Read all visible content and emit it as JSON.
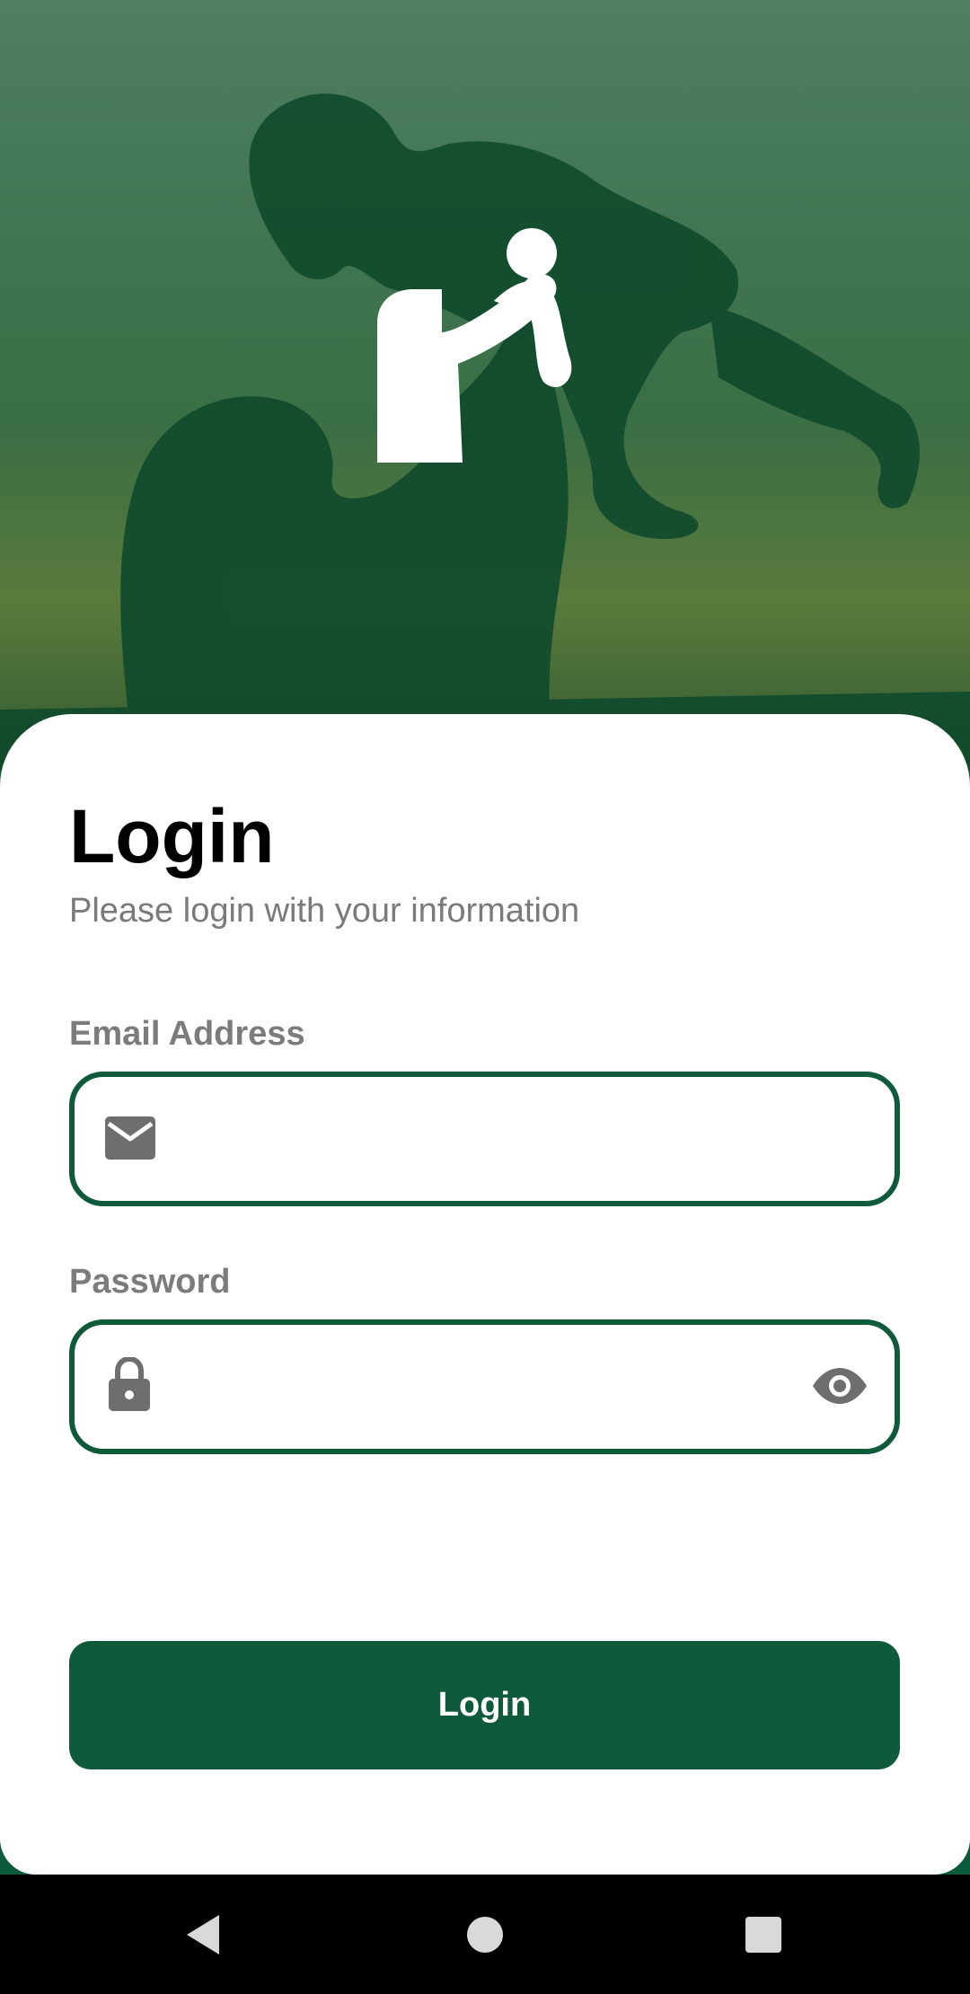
{
  "login": {
    "title": "Login",
    "subtitle": "Please login with your information"
  },
  "email": {
    "label": "Email Address",
    "value": "",
    "placeholder": "",
    "icon": "mail-icon"
  },
  "password": {
    "label": "Password",
    "value": "",
    "placeholder": "",
    "icon": "lock-icon",
    "toggle_icon": "eye-icon"
  },
  "actions": {
    "login_label": "Login"
  },
  "nav": {
    "back_icon": "back-triangle-icon",
    "home_icon": "home-circle-icon",
    "recents_icon": "recents-square-icon"
  },
  "colors": {
    "brand_green": "#0f5a3b",
    "label_gray": "#7c7c7c",
    "subtitle_gray": "#7a7a7a"
  }
}
